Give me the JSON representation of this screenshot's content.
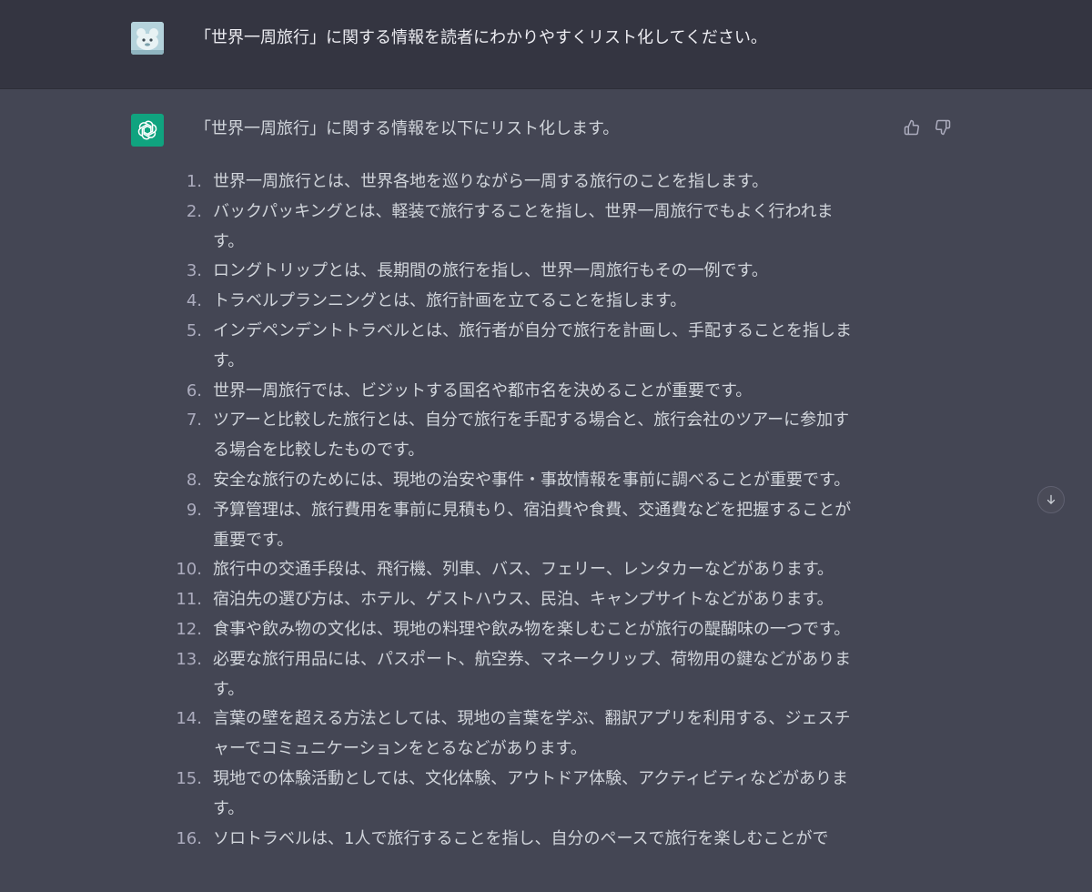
{
  "user_message": {
    "text": "「世界一周旅行」に関する情報を読者にわかりやすくリスト化してください。"
  },
  "assistant_message": {
    "intro": "「世界一周旅行」に関する情報を以下にリスト化します。",
    "items": [
      {
        "num": "1.",
        "lines": [
          "世界一周旅行とは、世界各地を巡りながら一周する旅行のことを指します。"
        ]
      },
      {
        "num": "2.",
        "lines": [
          "バックパッキングとは、軽装で旅行することを指し、世界一周旅行でもよく行われま",
          "す。"
        ]
      },
      {
        "num": "3.",
        "lines": [
          "ロングトリップとは、長期間の旅行を指し、世界一周旅行もその一例です。"
        ]
      },
      {
        "num": "4.",
        "lines": [
          "トラベルプランニングとは、旅行計画を立てることを指します。"
        ]
      },
      {
        "num": "5.",
        "lines": [
          "インデペンデントトラベルとは、旅行者が自分で旅行を計画し、手配することを指しま",
          "す。"
        ]
      },
      {
        "num": "6.",
        "lines": [
          "世界一周旅行では、ビジットする国名や都市名を決めることが重要です。"
        ]
      },
      {
        "num": "7.",
        "lines": [
          "ツアーと比較した旅行とは、自分で旅行を手配する場合と、旅行会社のツアーに参加す",
          "る場合を比較したものです。"
        ]
      },
      {
        "num": "8.",
        "lines": [
          "安全な旅行のためには、現地の治安や事件・事故情報を事前に調べることが重要です。"
        ]
      },
      {
        "num": "9.",
        "lines": [
          "予算管理は、旅行費用を事前に見積もり、宿泊費や食費、交通費などを把握することが",
          "重要です。"
        ]
      },
      {
        "num": "10.",
        "lines": [
          "旅行中の交通手段は、飛行機、列車、バス、フェリー、レンタカーなどがあります。"
        ]
      },
      {
        "num": "11.",
        "lines": [
          "宿泊先の選び方は、ホテル、ゲストハウス、民泊、キャンプサイトなどがあります。"
        ]
      },
      {
        "num": "12.",
        "lines": [
          "食事や飲み物の文化は、現地の料理や飲み物を楽しむことが旅行の醍醐味の一つです。"
        ]
      },
      {
        "num": "13.",
        "lines": [
          "必要な旅行用品には、パスポート、航空券、マネークリップ、荷物用の鍵などがありま",
          "す。"
        ]
      },
      {
        "num": "14.",
        "lines": [
          "言葉の壁を超える方法としては、現地の言葉を学ぶ、翻訳アプリを利用する、ジェスチ",
          "ャーでコミュニケーションをとるなどがあります。"
        ]
      },
      {
        "num": "15.",
        "lines": [
          "現地での体験活動としては、文化体験、アウトドア体験、アクティビティなどがありま",
          "す。"
        ]
      },
      {
        "num": "16.",
        "lines": [
          "ソロトラベルは、1人で旅行することを指し、自分のペースで旅行を楽しむことがで"
        ]
      }
    ]
  },
  "icons": {
    "user_avatar": "user-avatar-icon",
    "assistant_avatar": "openai-logo-icon",
    "thumbs_up": "thumbs-up-icon",
    "thumbs_down": "thumbs-down-icon",
    "scroll_down": "arrow-down-icon"
  },
  "colors": {
    "user_bg": "#343541",
    "assistant_bg": "#444654",
    "brand": "#10a37f",
    "text": "#d1d5db"
  }
}
